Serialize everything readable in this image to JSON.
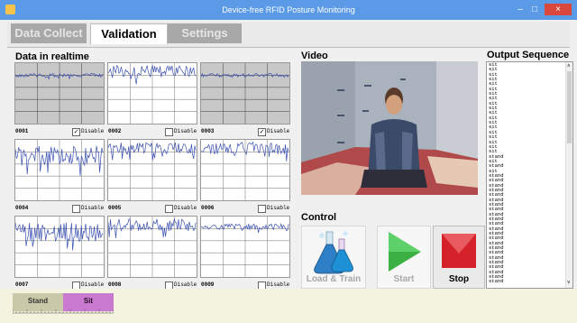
{
  "window": {
    "title": "Device-free RFID Posture Monitoring",
    "min_glyph": "–",
    "max_glyph": "□",
    "close_glyph": "×"
  },
  "tabs": [
    {
      "label": "Data Collect",
      "active": false
    },
    {
      "label": "Validation",
      "active": true
    },
    {
      "label": "Settings",
      "active": false
    }
  ],
  "realtime": {
    "title": "Data in realtime",
    "disable_label": "Disable",
    "panels": [
      {
        "id": "0001",
        "disabled": true,
        "style": "flat"
      },
      {
        "id": "0002",
        "disabled": false,
        "style": "noisy_high"
      },
      {
        "id": "0003",
        "disabled": true,
        "style": "flat"
      },
      {
        "id": "0004",
        "disabled": false,
        "style": "noisy_mid"
      },
      {
        "id": "0005",
        "disabled": false,
        "style": "noisy_high"
      },
      {
        "id": "0006",
        "disabled": false,
        "style": "noisy_high"
      },
      {
        "id": "0007",
        "disabled": false,
        "style": "noisy_mid"
      },
      {
        "id": "0008",
        "disabled": false,
        "style": "noisy_high"
      },
      {
        "id": "0009",
        "disabled": false,
        "style": "smooth_high"
      }
    ]
  },
  "video": {
    "title": "Video"
  },
  "output": {
    "title": "Output Sequence",
    "lines": [
      "sit",
      "sit",
      "sit",
      "sit",
      "sit",
      "sit",
      "sit",
      "sit",
      "sit",
      "sit",
      "sit",
      "sit",
      "sit",
      "sit",
      "sit",
      "sit",
      "sit",
      "sit",
      "sit",
      "stand",
      "sit",
      "stand",
      "sit",
      "stand",
      "stand",
      "stand",
      "stand",
      "stand",
      "stand",
      "stand",
      "stand",
      "stand",
      "stand",
      "stand",
      "stand",
      "stand",
      "stand",
      "stand",
      "stand",
      "stand",
      "stand",
      "stand",
      "stand",
      "stand",
      "stand",
      "stand"
    ]
  },
  "control": {
    "title": "Control",
    "load_train_label": "Load & Train",
    "start_label": "Start",
    "stop_label": "Stop"
  },
  "posture": {
    "stand_label": "Stand",
    "sit_label": "Sit",
    "current": "Sit"
  },
  "colors": {
    "titlebar": "#5a9ae6",
    "signal": "#3a50b0",
    "start": "#3cb043",
    "stop": "#d4212a",
    "sit_active": "#c97ad0"
  }
}
